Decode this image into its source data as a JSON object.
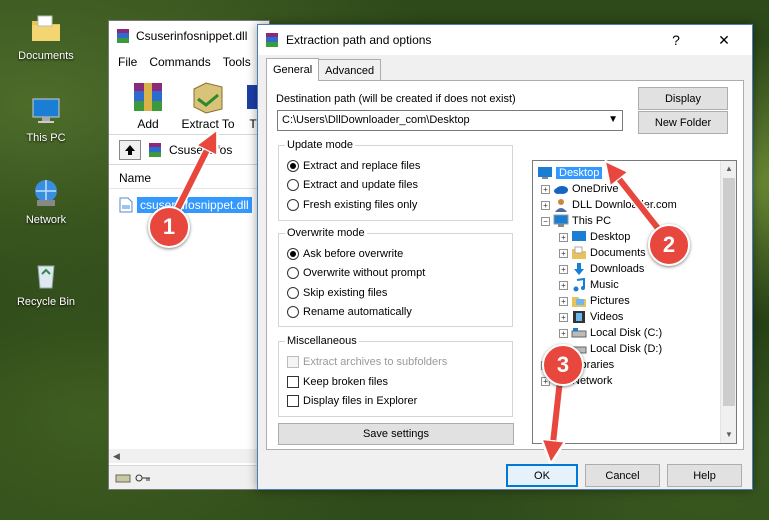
{
  "desktop": {
    "icons": [
      {
        "label": "Documents",
        "icon": "folder-icon"
      },
      {
        "label": "This PC",
        "icon": "computer-icon"
      },
      {
        "label": "Network",
        "icon": "network-icon"
      },
      {
        "label": "Recycle Bin",
        "icon": "recycle-bin-icon"
      }
    ]
  },
  "winrar": {
    "title": "Csuserinfosnippet.dll",
    "menu": [
      "File",
      "Commands",
      "Tools"
    ],
    "toolbar": {
      "add_label": "Add",
      "extract_label": "Extract To",
      "third_label": "T"
    },
    "address": "Csuserinfos",
    "list_header": "Name",
    "file": "csuserinfosnippet.dll"
  },
  "dialog": {
    "title": "Extraction path and options",
    "help_glyph": "?",
    "close_glyph": "✕",
    "tabs": {
      "general": "General",
      "advanced": "Advanced"
    },
    "destination_label": "Destination path (will be created if does not exist)",
    "destination_value": "C:\\Users\\DllDownloader_com\\Desktop",
    "display_button": "Display",
    "new_folder_button": "New Folder",
    "update_mode": {
      "title": "Update mode",
      "options": [
        "Extract and replace files",
        "Extract and update files",
        "Fresh existing files only"
      ],
      "selected": 0
    },
    "overwrite_mode": {
      "title": "Overwrite mode",
      "options": [
        "Ask before overwrite",
        "Overwrite without prompt",
        "Skip existing files",
        "Rename automatically"
      ],
      "selected": 0
    },
    "misc": {
      "title": "Miscellaneous",
      "extract_subfolders": "Extract archives to subfolders",
      "keep_broken": "Keep broken files",
      "display_in_explorer": "Display files in Explorer"
    },
    "save_settings": "Save settings",
    "tree": {
      "desktop": "Desktop",
      "onedrive": "OneDrive",
      "dll_user": "DLL Downloader.com",
      "this_pc": "This PC",
      "pc_desktop": "Desktop",
      "documents": "Documents",
      "downloads": "Downloads",
      "music": "Music",
      "pictures": "Pictures",
      "videos": "Videos",
      "local_c": "Local Disk (C:)",
      "local_d": "Local Disk (D:)",
      "libraries": "Libraries",
      "network": "Network"
    },
    "ok_button": "OK",
    "cancel_button": "Cancel",
    "help_button": "Help"
  },
  "annotations": {
    "step1": "1",
    "step2": "2",
    "step3": "3",
    "color": "#e8473e"
  }
}
